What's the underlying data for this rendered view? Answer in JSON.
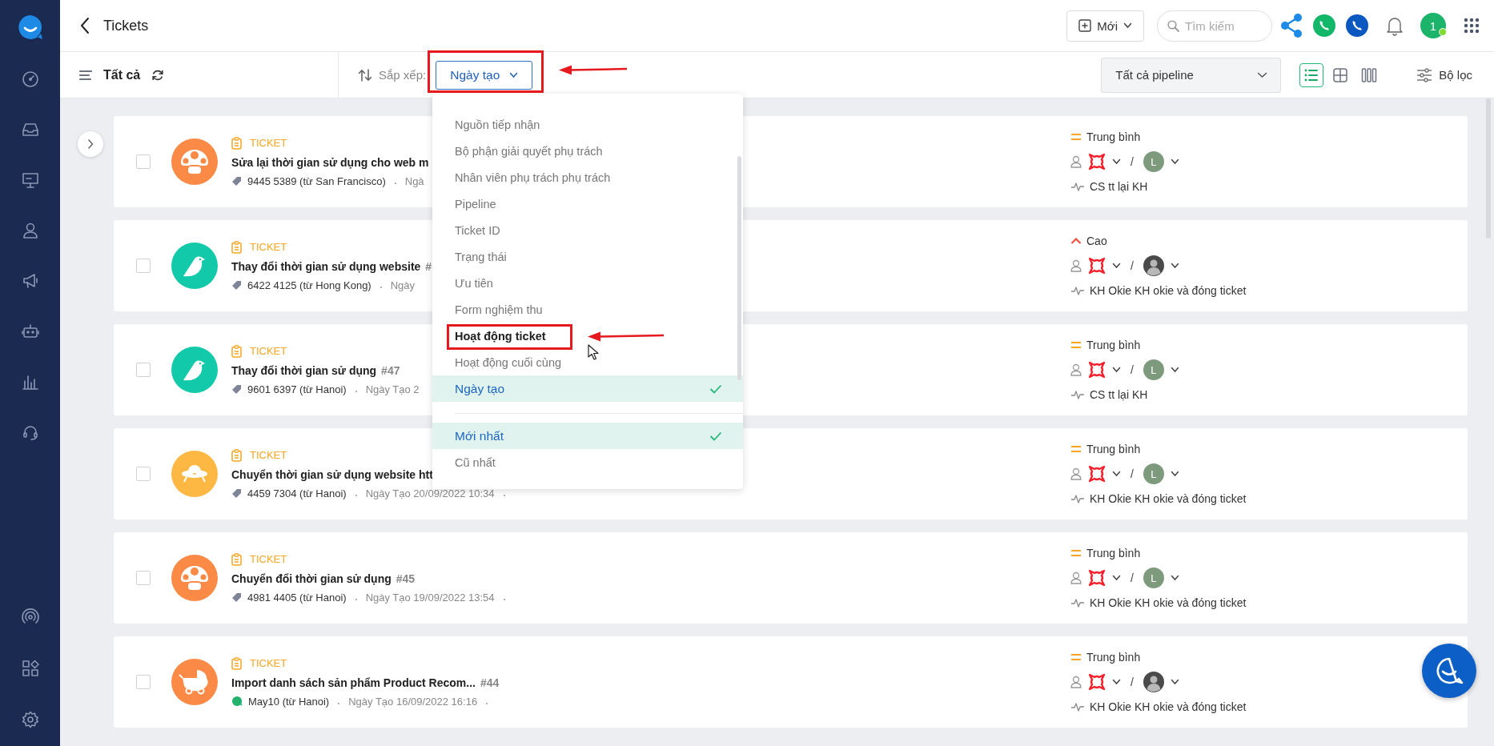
{
  "header": {
    "title": "Tickets",
    "new_button": "Mới",
    "search": {
      "placeholder": "Tìm kiếm"
    },
    "avatar": "1",
    "online": true
  },
  "toolbar": {
    "view_title": "Tất cả",
    "sort_label": "Sắp xếp:",
    "sort_button": "Ngày tạo",
    "pipeline": "Tất cả pipeline",
    "filter": "Bộ lọc",
    "views": [
      {
        "kind": "list",
        "selected": true
      },
      {
        "kind": "grid",
        "selected": false
      },
      {
        "kind": "columns",
        "selected": false
      }
    ]
  },
  "sort_menu": {
    "fields": [
      {
        "label": "Nguồn tiếp nhận",
        "selected": false,
        "hovered": false
      },
      {
        "label": "Bộ phận giải quyết phụ trách",
        "selected": false,
        "hovered": false
      },
      {
        "label": "Nhân viên phụ trách phụ trách",
        "selected": false,
        "hovered": false
      },
      {
        "label": "Pipeline",
        "selected": false,
        "hovered": false
      },
      {
        "label": "Ticket ID",
        "selected": false,
        "hovered": false
      },
      {
        "label": "Trạng thái",
        "selected": false,
        "hovered": false
      },
      {
        "label": "Ưu tiên",
        "selected": false,
        "hovered": false
      },
      {
        "label": "Form nghiệm thu",
        "selected": false,
        "hovered": false
      },
      {
        "label": "Hoạt động ticket",
        "selected": false,
        "hovered": true
      },
      {
        "label": "Hoạt động cuối cùng",
        "selected": false,
        "hovered": false
      },
      {
        "label": "Ngày tạo",
        "selected": true,
        "hovered": false
      }
    ],
    "orders": [
      {
        "label": "Mới nhất",
        "selected": true,
        "hovered": false
      },
      {
        "label": "Cũ nhất",
        "selected": false,
        "hovered": false
      }
    ]
  },
  "tickets": [
    {
      "checked": false,
      "type": "TICKET",
      "title": "Sửa lại thời gian sử dụng cho web m",
      "source": {
        "kind": "tag",
        "text": "9445 5389 (từ San Francisco)"
      },
      "created": "Ngà",
      "avatar": {
        "kind": "mushroom",
        "color": "#fb8a46"
      },
      "priority": {
        "kind": "medium",
        "label": "Trung bình"
      },
      "separator": "/",
      "assignee": {
        "kind": "letter",
        "text": "L"
      },
      "status": "CS tt lại KH"
    },
    {
      "checked": false,
      "type": "TICKET",
      "title": "Thay đổi thời gian sử dụng website",
      "number": "#",
      "source": {
        "kind": "tag",
        "text": "6422 4125 (từ Hong Kong)"
      },
      "created": "Ngày",
      "avatar": {
        "kind": "bird",
        "color": "#12c9a9"
      },
      "priority": {
        "kind": "high",
        "label": "Cao"
      },
      "separator": "/",
      "assignee": {
        "kind": "photo"
      },
      "status": "KH Okie KH okie và đóng ticket"
    },
    {
      "checked": false,
      "type": "TICKET",
      "title": "Thay đổi thời gian sử dụng",
      "number": "#47",
      "source": {
        "kind": "tag",
        "text": "9601 6397 (từ Hanoi)"
      },
      "created": "Ngày Tạo 2",
      "avatar": {
        "kind": "bird",
        "color": "#12c9a9"
      },
      "priority": {
        "kind": "medium",
        "label": "Trung bình"
      },
      "separator": "/",
      "assignee": {
        "kind": "letter",
        "text": "L"
      },
      "status": "CS tt lại KH"
    },
    {
      "checked": false,
      "type": "TICKET",
      "title": "Chuyển thời gian sử dụng website htt",
      "source": {
        "kind": "tag",
        "text": "4459 7304 (từ Hanoi)"
      },
      "created": "Ngày Tạo 20/09/2022 10:34",
      "avatar": {
        "kind": "ufo",
        "color": "#fdb843"
      },
      "priority": {
        "kind": "medium",
        "label": "Trung bình"
      },
      "separator": "/",
      "assignee": {
        "kind": "letter",
        "text": "L"
      },
      "status": "KH Okie KH okie và đóng ticket"
    },
    {
      "checked": false,
      "type": "TICKET",
      "title": "Chuyển đổi thời gian sử dụng",
      "number": "#45",
      "source": {
        "kind": "tag",
        "text": "4981 4405 (từ Hanoi)"
      },
      "created": "Ngày Tạo 19/09/2022 13:54",
      "avatar": {
        "kind": "mushroom",
        "color": "#fb8a46"
      },
      "priority": {
        "kind": "medium",
        "label": "Trung bình"
      },
      "separator": "/",
      "assignee": {
        "kind": "letter",
        "text": "L"
      },
      "status": "KH Okie KH okie và đóng ticket"
    },
    {
      "checked": false,
      "type": "TICKET",
      "title": "Import danh sách sản phẩm Product Recom...",
      "number": "#44",
      "source": {
        "kind": "chat",
        "text": "May10 (từ Hanoi)"
      },
      "created": "Ngày Tạo 16/09/2022 16:16",
      "avatar": {
        "kind": "stroller",
        "color": "#fb8a46"
      },
      "priority": {
        "kind": "medium",
        "label": "Trung bình"
      },
      "separator": "/",
      "assignee": {
        "kind": "photo"
      },
      "status": "KH Okie KH okie và đóng ticket"
    }
  ]
}
